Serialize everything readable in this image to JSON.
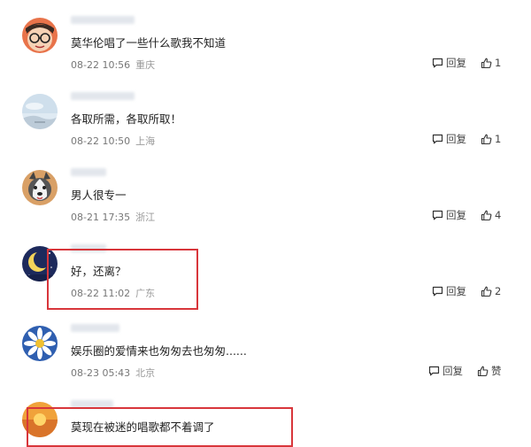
{
  "comments": [
    {
      "text": "莫华伦唱了一些什么歌我不知道",
      "date": "08-22 10:56",
      "location": "重庆",
      "reply_label": "回复",
      "like": "1",
      "avatar_icon": "cartoon-boy-glasses-avatar"
    },
    {
      "text": "各取所需，各取所取！",
      "date": "08-22 10:50",
      "location": "上海",
      "reply_label": "回复",
      "like": "1",
      "avatar_icon": "sky-landscape-avatar"
    },
    {
      "text": "男人很专一",
      "date": "08-21 17:35",
      "location": "浙江",
      "reply_label": "回复",
      "like": "4",
      "avatar_icon": "husky-dog-avatar"
    },
    {
      "text": "好，还离？",
      "date": "08-22 11:02",
      "location": "广东",
      "reply_label": "回复",
      "like": "2",
      "avatar_icon": "night-moon-avatar"
    },
    {
      "text": "娱乐圈的爱情来也匆匆去也匆匆......",
      "date": "08-23 05:43",
      "location": "北京",
      "reply_label": "回复",
      "like": "赞",
      "avatar_icon": "daisy-flower-avatar"
    },
    {
      "text": "莫现在被迷的唱歌都不着调了",
      "avatar_icon": "sunset-avatar"
    }
  ],
  "colors": {
    "highlight": "#d8363b",
    "meta": "#777777"
  }
}
